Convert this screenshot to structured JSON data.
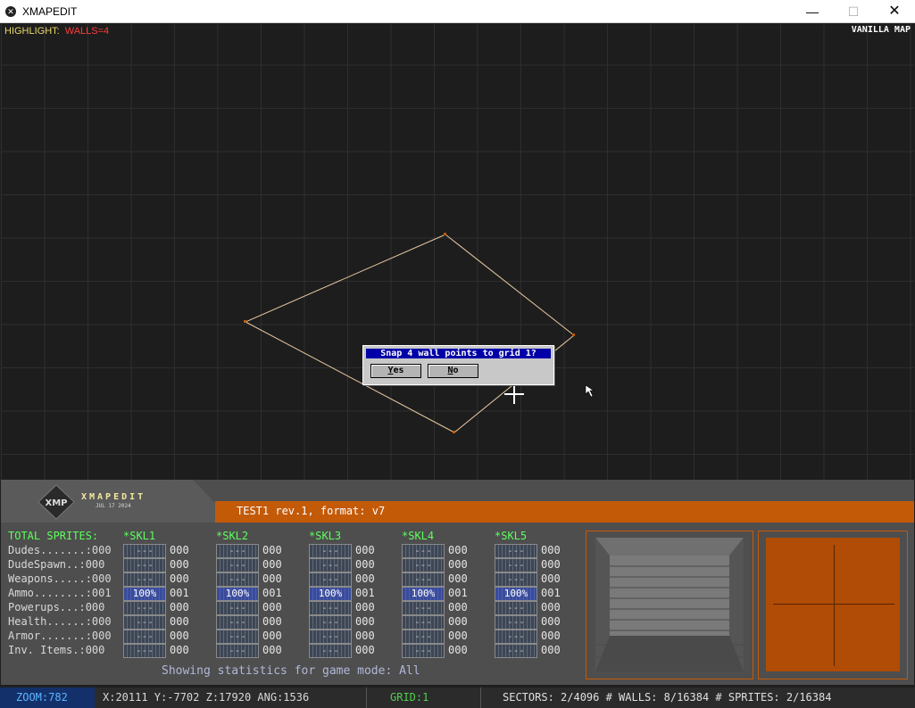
{
  "window": {
    "title": "XMAPEDIT"
  },
  "map": {
    "highlight_key": "HIGHLIGHT:",
    "highlight_value": "WALLS=4",
    "vanilla": "VANILLA MAP"
  },
  "dialog": {
    "title": "Snap 4 wall points to grid 1?",
    "yes_label": "es",
    "yes_mnemonic": "Y",
    "no_label": "o",
    "no_mnemonic": "N"
  },
  "logo": {
    "name": "XMAPEDIT",
    "date": "JUL 17 2024",
    "badge": "XMP"
  },
  "mapinfo": {
    "title": "TEST1 rev.1, format: v7"
  },
  "stats": {
    "total_label": "TOTAL SPRITES:",
    "skills": [
      "*SKL1",
      "*SKL2",
      "*SKL3",
      "*SKL4",
      "*SKL5"
    ],
    "rows": [
      {
        "label": "Dudes.......:000",
        "cells": [
          "---",
          "---",
          "---",
          "---",
          "---"
        ],
        "vals": [
          "000",
          "000",
          "000",
          "000",
          "000"
        ]
      },
      {
        "label": "DudeSpawn..:000",
        "cells": [
          "---",
          "---",
          "---",
          "---",
          "---"
        ],
        "vals": [
          "000",
          "000",
          "000",
          "000",
          "000"
        ]
      },
      {
        "label": "Weapons.....:000",
        "cells": [
          "---",
          "---",
          "---",
          "---",
          "---"
        ],
        "vals": [
          "000",
          "000",
          "000",
          "000",
          "000"
        ]
      },
      {
        "label": "Ammo........:001",
        "cells": [
          "100%",
          "100%",
          "100%",
          "100%",
          "100%"
        ],
        "vals": [
          "001",
          "001",
          "001",
          "001",
          "001"
        ]
      },
      {
        "label": "Powerups...:000",
        "cells": [
          "---",
          "---",
          "---",
          "---",
          "---"
        ],
        "vals": [
          "000",
          "000",
          "000",
          "000",
          "000"
        ]
      },
      {
        "label": "Health......:000",
        "cells": [
          "---",
          "---",
          "---",
          "---",
          "---"
        ],
        "vals": [
          "000",
          "000",
          "000",
          "000",
          "000"
        ]
      },
      {
        "label": "Armor.......:000",
        "cells": [
          "---",
          "---",
          "---",
          "---",
          "---"
        ],
        "vals": [
          "000",
          "000",
          "000",
          "000",
          "000"
        ]
      },
      {
        "label": "Inv. Items.:000",
        "cells": [
          "---",
          "---",
          "---",
          "---",
          "---"
        ],
        "vals": [
          "000",
          "000",
          "000",
          "000",
          "000"
        ]
      }
    ],
    "footer": "Showing statistics for game mode: All"
  },
  "status": {
    "zoom": "ZOOM:782",
    "coords": "X:20111  Y:-7702  Z:17920  ANG:1536",
    "grid": "GRID:1",
    "counts": "SECTORS: 2/4096 # WALLS: 8/16384 # SPRITES: 2/16384"
  },
  "colors": {
    "accent": "#c35a08",
    "dialog_title": "#0000a8",
    "skill_header": "#5cff5c",
    "wall_line": "#e6c8a0"
  },
  "icons": [
    "app-icon",
    "minimize-icon",
    "maximize-icon",
    "close-icon",
    "crosshair-cursor-icon",
    "mouse-arrow-icon",
    "xmp-logo-icon"
  ]
}
